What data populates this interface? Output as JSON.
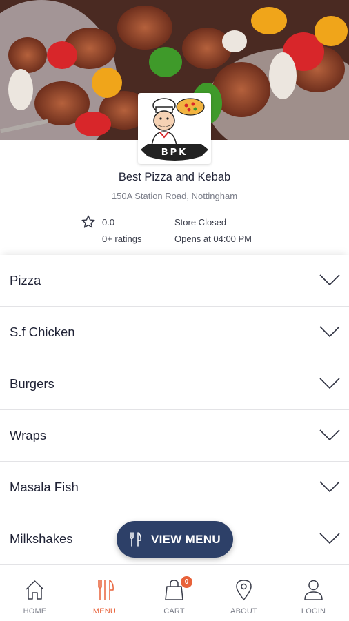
{
  "store": {
    "name": "Best Pizza and Kebab",
    "address": "150A Station Road, Nottingham",
    "logo_text": "BPK",
    "rating": "0.0",
    "ratings_count": "0+ ratings",
    "status": "Store Closed",
    "opens_at": "Opens at 04:00 PM"
  },
  "categories": [
    {
      "label": "Pizza"
    },
    {
      "label": "S.f Chicken"
    },
    {
      "label": "Burgers"
    },
    {
      "label": "Wraps"
    },
    {
      "label": "Masala Fish"
    },
    {
      "label": "Milkshakes"
    }
  ],
  "view_menu": {
    "label": "VIEW MENU",
    "icon": "cutlery-icon"
  },
  "nav": {
    "items": [
      {
        "label": "HOME",
        "icon": "home-icon"
      },
      {
        "label": "MENU",
        "icon": "cutlery-icon"
      },
      {
        "label": "CART",
        "icon": "cart-bag-icon"
      },
      {
        "label": "ABOUT",
        "icon": "location-pin-icon"
      },
      {
        "label": "LOGIN",
        "icon": "user-icon"
      }
    ],
    "active": "MENU",
    "cart_count": "0"
  },
  "colors": {
    "accent": "#e8623a",
    "button": "#2d4068",
    "text": "#1f2235",
    "muted": "#7c7f8a"
  }
}
